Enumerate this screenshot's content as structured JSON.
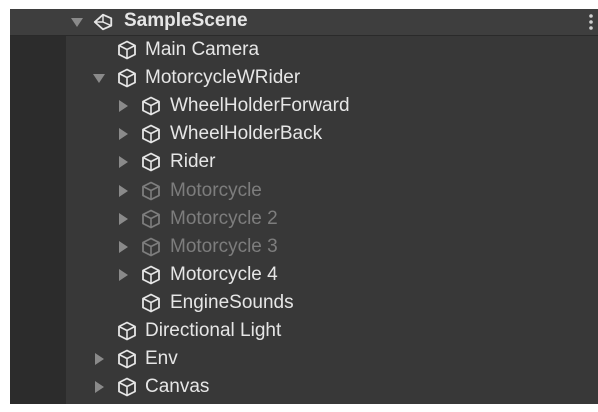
{
  "scene": {
    "name": "SampleScene",
    "icon": "unity-scene-icon",
    "menu_icon": "vertical-dots-menu-icon"
  },
  "colors": {
    "panel_bg": "#383838",
    "text": "#e6e6e6",
    "inactive_text": "#7d7d7d",
    "arrow": "#8a8a8a"
  },
  "hierarchy": {
    "items": [
      {
        "label": "Main Camera",
        "expander": "none",
        "active": true,
        "icon": "gameobject-cube-icon"
      },
      {
        "label": "MotorcycleWRider",
        "expander": "expanded",
        "active": true,
        "icon": "gameobject-cube-icon"
      },
      {
        "label": "WheelHolderForward",
        "expander": "collapsed",
        "active": true,
        "icon": "gameobject-cube-icon"
      },
      {
        "label": "WheelHolderBack",
        "expander": "collapsed",
        "active": true,
        "icon": "gameobject-cube-icon"
      },
      {
        "label": "Rider",
        "expander": "collapsed",
        "active": true,
        "icon": "gameobject-cube-icon"
      },
      {
        "label": "Motorcycle",
        "expander": "collapsed",
        "active": false,
        "icon": "gameobject-cube-icon"
      },
      {
        "label": "Motorcycle 2",
        "expander": "collapsed",
        "active": false,
        "icon": "gameobject-cube-icon"
      },
      {
        "label": "Motorcycle 3",
        "expander": "collapsed",
        "active": false,
        "icon": "gameobject-cube-icon"
      },
      {
        "label": "Motorcycle 4",
        "expander": "collapsed",
        "active": true,
        "icon": "gameobject-cube-icon"
      },
      {
        "label": "EngineSounds",
        "expander": "none",
        "active": true,
        "icon": "gameobject-cube-icon"
      },
      {
        "label": "Directional Light",
        "expander": "none",
        "active": true,
        "icon": "gameobject-cube-icon"
      },
      {
        "label": "Env",
        "expander": "collapsed",
        "active": true,
        "icon": "gameobject-cube-icon"
      },
      {
        "label": "Canvas",
        "expander": "collapsed",
        "active": true,
        "icon": "gameobject-cube-icon"
      }
    ]
  }
}
